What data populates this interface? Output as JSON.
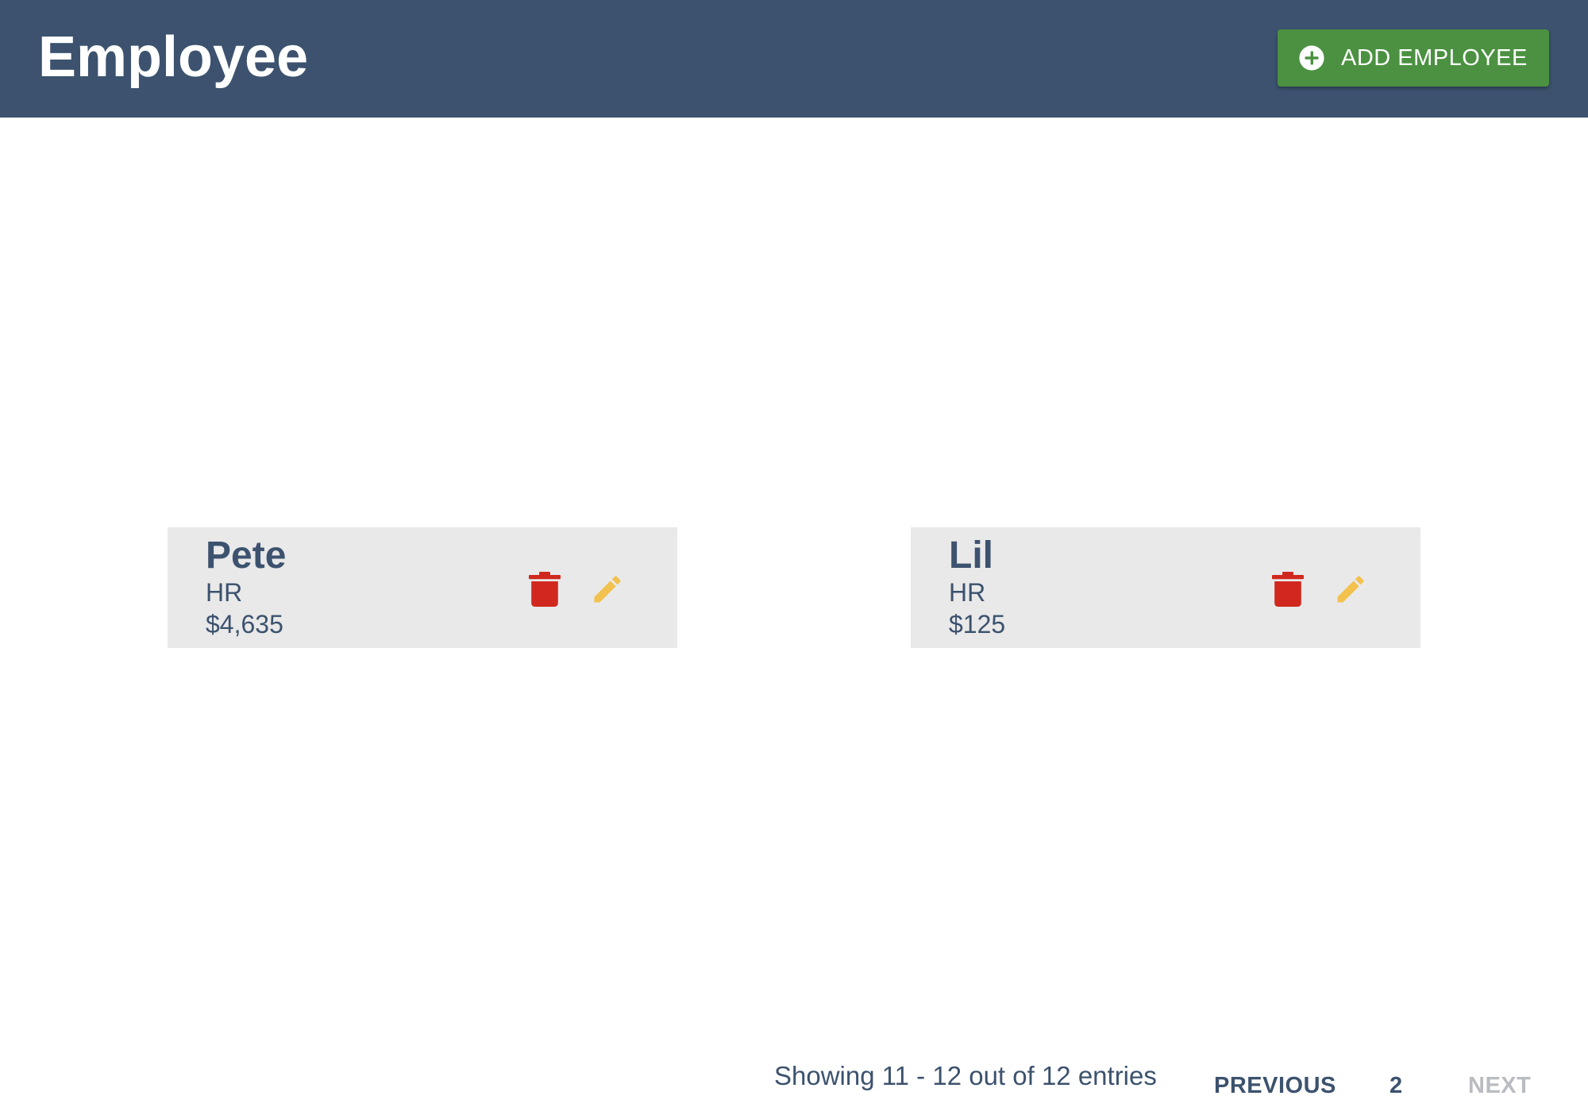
{
  "header": {
    "title": "Employee",
    "add_button_label": "ADD EMPLOYEE"
  },
  "employees": [
    {
      "name": "Pete",
      "department": "HR",
      "salary": "$4,635"
    },
    {
      "name": "Lil",
      "department": "HR",
      "salary": "$125"
    }
  ],
  "icons": {
    "add": "plus-circle-icon",
    "delete": "trash-icon",
    "edit": "pencil-icon"
  },
  "colors": {
    "header_bg": "#3c526e",
    "add_button_bg": "#4b9141",
    "delete_icon": "#d0281f",
    "edit_icon": "#f2c14e",
    "card_bg": "#e9e9e9",
    "disabled_text": "#b9bcc1"
  },
  "pagination": {
    "summary": "Showing 11 - 12 out of 12 entries",
    "previous_label": "PREVIOUS",
    "current_page": "2",
    "next_label": "NEXT"
  }
}
